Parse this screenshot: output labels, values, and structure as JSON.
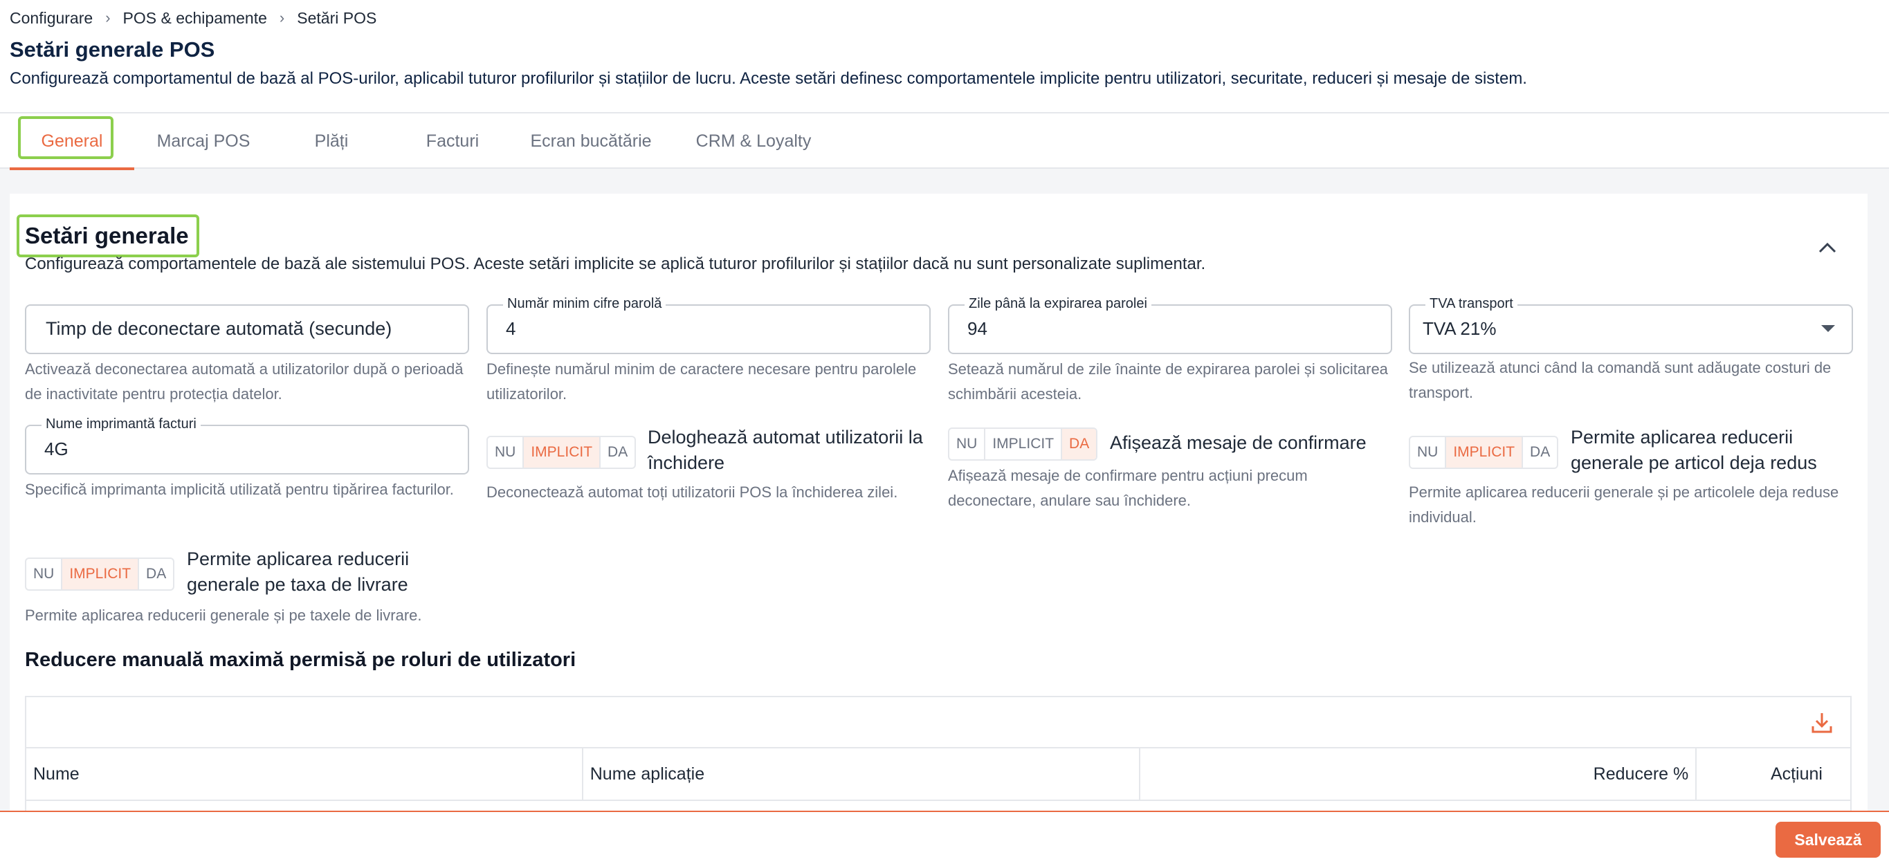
{
  "breadcrumb": [
    "Configurare",
    "POS & echipamente",
    "Setări POS"
  ],
  "breadcrumb_sep": "›",
  "page": {
    "title": "Setări generale POS",
    "subtitle": "Configurează comportamentul de bază al POS-urilor, aplicabil tuturor profilurilor și stațiilor de lucru. Aceste setări definesc comportamentele implicite pentru utilizatori, securitate, reduceri și mesaje de sistem."
  },
  "tabs": [
    "General",
    "Marcaj POS",
    "Plăți",
    "Facturi",
    "Ecran bucătărie",
    "CRM & Loyalty"
  ],
  "active_tab": "General",
  "section": {
    "title": "Setări generale",
    "description": "Configurează comportamentele de bază ale sistemului POS. Aceste setări implicite se aplică tuturor profilurilor și stațiilor dacă nu sunt personalizate suplimentar.",
    "collapse_icon": "chevron-up-icon"
  },
  "fields": {
    "auto_logout": {
      "placeholder": "Timp de deconectare automată (secunde)",
      "help": "Activează deconectarea automată a utilizatorilor după o perioadă de inactivitate pentru protecția datelor."
    },
    "min_password_digits": {
      "label": "Număr minim cifre parolă",
      "value": "4",
      "help": "Definește numărul minim de caractere necesare pentru parolele utilizatorilor."
    },
    "password_expiry_days": {
      "label": "Zile până la expirarea parolei",
      "value": "94",
      "help": "Setează numărul de zile înainte de expirarea parolei și solicitarea schimbării acesteia."
    },
    "shipping_vat": {
      "label": "TVA transport",
      "value": "TVA 21%",
      "help": "Se utilizează atunci când la comandă sunt adăugate costuri de transport."
    },
    "invoice_printer": {
      "label": "Nume imprimantă facturi",
      "value": "4G",
      "help": "Specifică imprimanta implicită utilizată pentru tipărirea facturilor."
    }
  },
  "toggle_options": [
    "NU",
    "IMPLICIT",
    "DA"
  ],
  "toggles": {
    "logout_on_close": {
      "label": "Deloghează automat utilizatorii la închidere",
      "selected": "IMPLICIT",
      "help": "Deconectează automat toți utilizatorii POS la închiderea zilei."
    },
    "confirm_messages": {
      "label": "Afișează mesaje de confirmare",
      "selected": "DA",
      "help": "Afișează mesaje de confirmare pentru acțiuni precum deconectare, anulare sau închidere."
    },
    "discount_on_discounted": {
      "label": "Permite aplicarea reducerii generale pe articol deja redus",
      "selected": "IMPLICIT",
      "help": "Permite aplicarea reducerii generale și pe articolele deja reduse individual."
    },
    "discount_on_delivery": {
      "label": "Permite aplicarea reducerii generale pe taxa de livrare",
      "selected": "IMPLICIT",
      "help": "Permite aplicarea reducerii generale și pe taxele de livrare."
    }
  },
  "discounts_table": {
    "title": "Reducere manuală maximă permisă pe roluri de utilizatori",
    "columns": [
      "Nume",
      "Nume aplicație",
      "Reducere %",
      "Acțiuni"
    ],
    "toolbar_icon": "download-icon"
  },
  "footer": {
    "save_label": "Salvează"
  },
  "colors": {
    "accent": "#ea6a42",
    "highlight": "#8ccf4d",
    "title": "#0f2342"
  }
}
